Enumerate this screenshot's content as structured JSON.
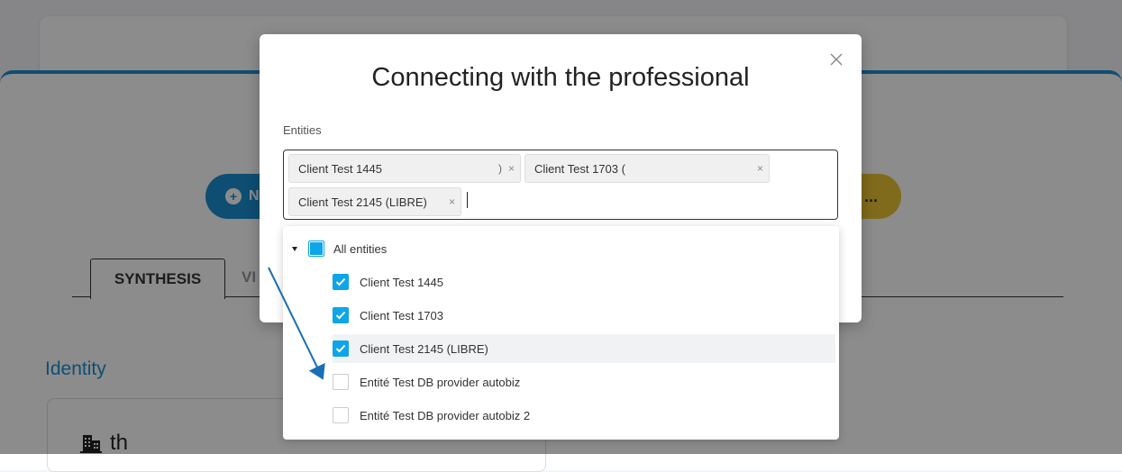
{
  "background": {
    "left_button_text": "N",
    "right_button_text": "...",
    "tabs": [
      {
        "label": "SYNTHESIS"
      },
      {
        "label": "VI"
      }
    ],
    "identity_heading": "Identity",
    "identity_card_text": "th"
  },
  "modal": {
    "title": "Connecting with the professional",
    "field_label": "Entities",
    "selected_tags": [
      {
        "label": "Client Test 1445",
        "remove": "×"
      },
      {
        "label": "Client Test 1703 (",
        "remove": "×"
      },
      {
        "label": "Client Test 2145 (LIBRE)",
        "remove": "×"
      }
    ],
    "tag_fragment": ")"
  },
  "dropdown": {
    "all_label": "All entities",
    "items": [
      {
        "label": "Client Test 1445",
        "checked": true
      },
      {
        "label": "Client Test 1703",
        "checked": true
      },
      {
        "label": "Client Test 2145 (LIBRE)",
        "checked": true
      },
      {
        "label": "Entité Test DB provider autobiz",
        "checked": false
      },
      {
        "label": "Entité Test DB provider autobiz 2",
        "checked": false
      }
    ]
  },
  "colors": {
    "accent": "#0ea5e9",
    "brand_blue": "#1a8fd1",
    "brand_yellow": "#e9c233",
    "annotation_arrow": "#1a6fb5"
  }
}
